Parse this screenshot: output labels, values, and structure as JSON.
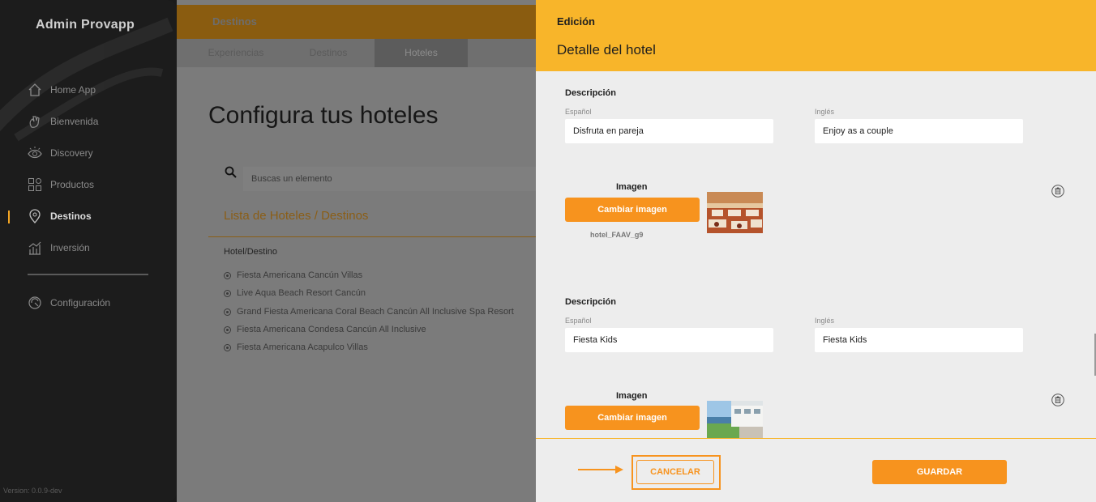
{
  "sidebar": {
    "brand": "Admin Provapp",
    "items": [
      {
        "label": "Home App",
        "icon": "home-icon"
      },
      {
        "label": "Bienvenida",
        "icon": "wave-hand-icon"
      },
      {
        "label": "Discovery",
        "icon": "eye-icon"
      },
      {
        "label": "Productos",
        "icon": "grid-icon"
      },
      {
        "label": "Destinos",
        "icon": "location-pin-icon",
        "active": true
      },
      {
        "label": "Inversión",
        "icon": "bar-chart-icon"
      }
    ],
    "settings": {
      "label": "Configuración",
      "icon": "settings-icon"
    },
    "version": "Version: 0.0.9-dev"
  },
  "main": {
    "topbar_title": "Destinos",
    "tabs": [
      {
        "label": "Experiencias"
      },
      {
        "label": "Destinos"
      },
      {
        "label": "Hoteles",
        "active": true
      }
    ],
    "heading": "Configura tus hoteles",
    "search_placeholder": "Buscas un elemento",
    "list_title": "Lista de Hoteles / Destinos",
    "column_header": "Hotel/Destino",
    "hotels": [
      "Fiesta Americana Cancún Villas",
      "Live Aqua Beach Resort Cancún",
      "Grand Fiesta Americana Coral Beach Cancún All Inclusive Spa Resort",
      "Fiesta Americana Condesa Cancún All Inclusive",
      "Fiesta Americana Acapulco Villas"
    ]
  },
  "panel": {
    "kicker": "Edición",
    "title": "Detalle del hotel",
    "sections": [
      {
        "desc_label": "Descripción",
        "es_label": "Español",
        "en_label": "Inglés",
        "es_value": "Disfruta en pareja",
        "en_value": "Enjoy as a couple",
        "image_label": "Imagen",
        "change_button": "Cambiar imagen",
        "filename": "hotel_FAAV_g9"
      },
      {
        "desc_label": "Descripción",
        "es_label": "Español",
        "en_label": "Inglés",
        "es_value": "Fiesta Kids",
        "en_value": "Fiesta Kids",
        "image_label": "Imagen",
        "change_button": "Cambiar imagen"
      }
    ],
    "cancel_button": "CANCELAR",
    "save_button": "GUARDAR"
  },
  "colors": {
    "accent": "#f7931e",
    "header": "#f8b52a",
    "sidebar": "#1c1c1c"
  }
}
